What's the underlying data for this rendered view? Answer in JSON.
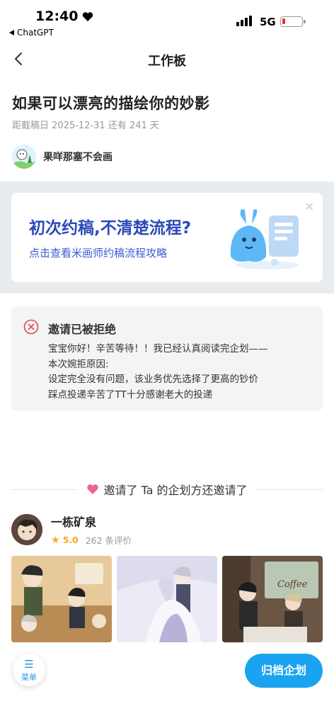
{
  "status_bar": {
    "time": "12:40",
    "back_app": "ChatGPT",
    "network": "5G"
  },
  "nav": {
    "title": "工作板"
  },
  "project": {
    "title": "如果可以漂亮的描绘你的妙影",
    "deadline": "距截稿日 2025-12-31 还有 241 天"
  },
  "author": {
    "name": "果咩那塞不会画"
  },
  "banner": {
    "headline": "初次约稿,不清楚流程?",
    "subline": "点击查看米画师约稿流程攻略"
  },
  "rejection": {
    "title": "邀请已被拒绝",
    "lines": [
      "宝宝你好！辛苦等待！！我已经认真阅读完企划——",
      "本次婉拒原因:",
      "设定完全没有问题，该业务优先选择了更高的钞价",
      "踩点投递辛苦了TT十分感谢老大的投递"
    ]
  },
  "invite": {
    "label": "邀请了 Ta 的企划方还邀请了"
  },
  "artist": {
    "name": "一栋矿泉",
    "rating": "5.0",
    "reviews": "262 条评价"
  },
  "gallery": {
    "coffee_sign": "Coffee"
  },
  "bottom": {
    "menu_glyph": "☰",
    "menu_label": "菜单",
    "archive_label": "归档企划"
  },
  "colors": {
    "accent": "#1aa3f0",
    "banner_title": "#2b4ab8",
    "rating": "#f5a623",
    "reject_icon": "#e5484d"
  }
}
